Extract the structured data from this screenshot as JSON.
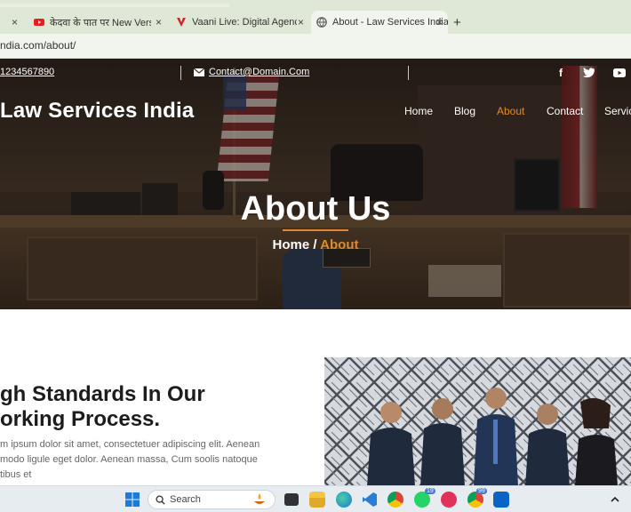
{
  "browser": {
    "tabs": [
      {
        "title": "",
        "active": false
      },
      {
        "title": "केदवा के पात पर New Version, K",
        "active": false
      },
      {
        "title": "Vaani Live: Digital Agency, Web",
        "active": false
      },
      {
        "title": "About - Law Services India",
        "active": true
      }
    ],
    "new_tab_label": "+",
    "close_label": "×",
    "url": "ndia.com/about/"
  },
  "topbar": {
    "phone": "1234567890",
    "email": "Contact@Domain.Com",
    "social": [
      "facebook-icon",
      "twitter-icon",
      "youtube-icon"
    ]
  },
  "header": {
    "brand": "Law Services India",
    "nav": [
      {
        "label": "Home"
      },
      {
        "label": "Blog"
      },
      {
        "label": "About",
        "active": true
      },
      {
        "label": "Contact"
      },
      {
        "label": "Servic"
      }
    ]
  },
  "hero": {
    "title": "About Us",
    "breadcrumb_home": "Home",
    "breadcrumb_sep": " / ",
    "breadcrumb_current": "About"
  },
  "content": {
    "heading_line1": "gh Standards In Our",
    "heading_line2": "orking Process.",
    "para_line1": "m ipsum dolor sit amet, consectetuer adipiscing elit. Aenean",
    "para_line2": "modo ligule eget dolor. Aenean massa, Cum soolis natoque",
    "para_line3": "tibus et"
  },
  "taskbar": {
    "search_placeholder": "Search",
    "whatsapp_badge": "19",
    "chrome_badge": "99"
  },
  "colors": {
    "accent": "#e08a2e",
    "hero_dark": "#3a2d24",
    "tab_bar": "#dfe7d6"
  }
}
